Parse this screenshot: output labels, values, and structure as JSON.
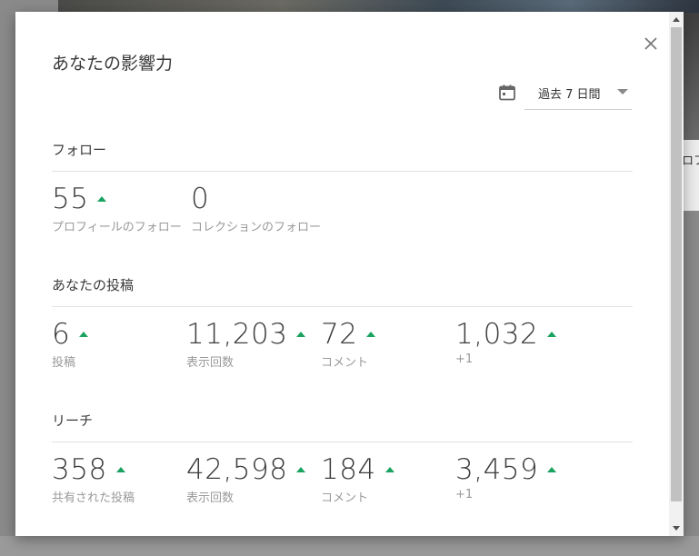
{
  "modal": {
    "title": "あなたの影響力",
    "date_range": "過去 7 日間"
  },
  "sections": {
    "follow": {
      "title": "フォロー",
      "stats": [
        {
          "value": "55",
          "label": "プロフィールのフォロー",
          "trend": "up"
        },
        {
          "value": "0",
          "label": "コレクションのフォロー",
          "trend": "none"
        }
      ]
    },
    "posts": {
      "title": "あなたの投稿",
      "stats": [
        {
          "value": "6",
          "label": "投稿",
          "trend": "up"
        },
        {
          "value": "11,203",
          "label": "表示回数",
          "trend": "up"
        },
        {
          "value": "72",
          "label": "コメント",
          "trend": "up"
        },
        {
          "value": "1,032",
          "label": "+1",
          "trend": "up"
        }
      ]
    },
    "reach": {
      "title": "リーチ",
      "stats": [
        {
          "value": "358",
          "label": "共有された投稿",
          "trend": "up"
        },
        {
          "value": "42,598",
          "label": "表示回数",
          "trend": "up"
        },
        {
          "value": "184",
          "label": "コメント",
          "trend": "up"
        },
        {
          "value": "3,459",
          "label": "+1",
          "trend": "up"
        }
      ]
    }
  },
  "background": {
    "right_card_text": "ロフ"
  },
  "colors": {
    "trend_up": "#1aa260",
    "text_primary": "#3c3c3c",
    "text_secondary": "#9a9a9a"
  }
}
